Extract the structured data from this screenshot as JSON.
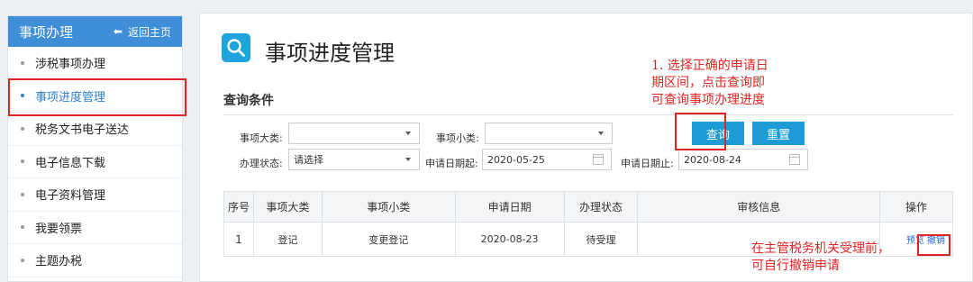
{
  "sidebar": {
    "title": "事项办理",
    "back_label": "返回主页",
    "items": [
      {
        "label": "涉税事项办理"
      },
      {
        "label": "事项进度管理"
      },
      {
        "label": "税务文书电子送达"
      },
      {
        "label": "电子信息下载"
      },
      {
        "label": "电子资料管理"
      },
      {
        "label": "我要领票"
      },
      {
        "label": "主题办税"
      }
    ]
  },
  "main": {
    "title": "事项进度管理",
    "section_label": "查询条件"
  },
  "filters": {
    "category_label": "事项大类:",
    "category_value": "",
    "subcategory_label": "事项小类:",
    "subcategory_value": "",
    "status_label": "办理状态:",
    "status_value": "请选择",
    "date_from_label": "申请日期起:",
    "date_from_value": "2020-05-25",
    "date_to_label": "申请日期止:",
    "date_to_value": "2020-08-24",
    "query_label": "查询",
    "reset_label": "重置"
  },
  "table": {
    "headers": [
      "序号",
      "事项大类",
      "事项小类",
      "申请日期",
      "办理状态",
      "审核信息",
      "操作"
    ],
    "rows": [
      {
        "index": "1",
        "category": "登记",
        "subcategory": "变更登记",
        "date": "2020-08-23",
        "status": "待受理",
        "review": "",
        "preview": "预览",
        "revoke": "撤销"
      }
    ]
  },
  "annotations": {
    "note1_line1": "1. 选择正确的申请日",
    "note1_line2": "期区间，点击查询即",
    "note1_line3": "可查询事项办理进度",
    "note2_line1": "在主管税务机关受理前，",
    "note2_line2": "可自行撤销申请"
  },
  "colors": {
    "accent": "#1c9bd6",
    "sidebar_header": "#3e8fd8",
    "annotation_red": "#e02424"
  }
}
